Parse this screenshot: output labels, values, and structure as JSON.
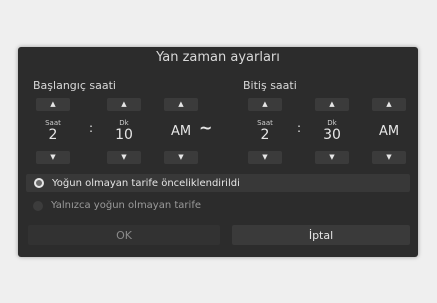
{
  "dialog": {
    "title": "Yan zaman ayarları",
    "start": {
      "label": "Başlangıç saati",
      "hour_unit": "Saat",
      "hour": "2",
      "minute_unit": "Dk",
      "minute": "10",
      "ampm": "AM"
    },
    "end": {
      "label": "Bitiş saati",
      "hour_unit": "Saat",
      "hour": "2",
      "minute_unit": "Dk",
      "minute": "30",
      "ampm": "AM"
    },
    "time_separator": ":",
    "range_separator": "~",
    "options": [
      {
        "label": "Yoğun olmayan tarife önceliklendirildi",
        "selected": true
      },
      {
        "label": "Yalnızca yoğun olmayan tarife",
        "selected": false
      }
    ],
    "buttons": {
      "ok": "OK",
      "cancel": "İptal"
    },
    "icons": {
      "up": "▲",
      "down": "▼"
    }
  }
}
